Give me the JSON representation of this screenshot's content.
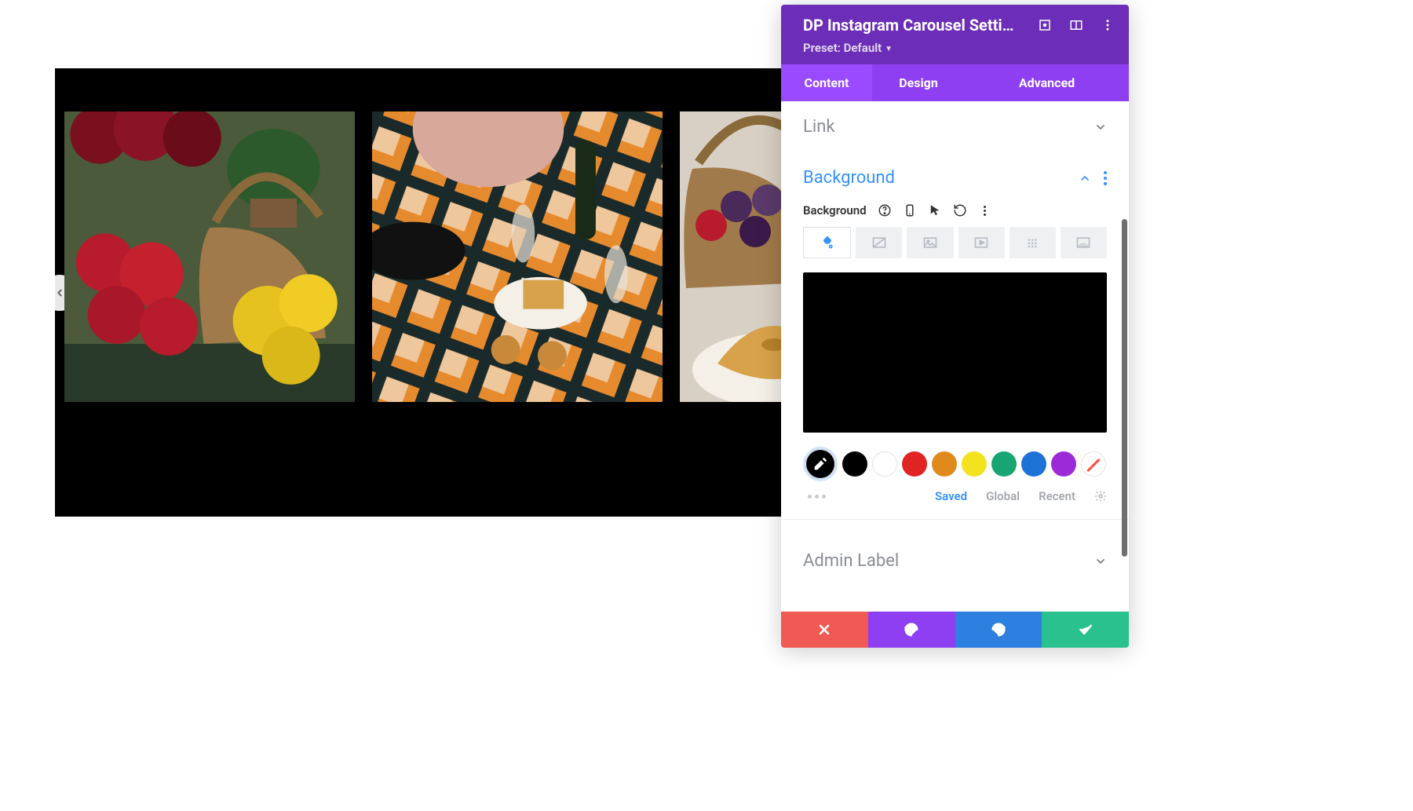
{
  "panel": {
    "title": "DP Instagram Carousel Setti…",
    "preset_label": "Preset: Default"
  },
  "tabs": {
    "content": "Content",
    "design": "Design",
    "advanced": "Advanced"
  },
  "accordion": {
    "link": "Link",
    "background": "Background",
    "admin_label": "Admin Label"
  },
  "background": {
    "field_label": "Background",
    "preview_color": "#000000",
    "swatches": [
      "#000000",
      "#ffffff",
      "#e02424",
      "#e08a1e",
      "#f5e21e",
      "#17a673",
      "#1d72d6",
      "#9b2bd9"
    ]
  },
  "palette_tabs": {
    "saved": "Saved",
    "global": "Global",
    "recent": "Recent"
  }
}
